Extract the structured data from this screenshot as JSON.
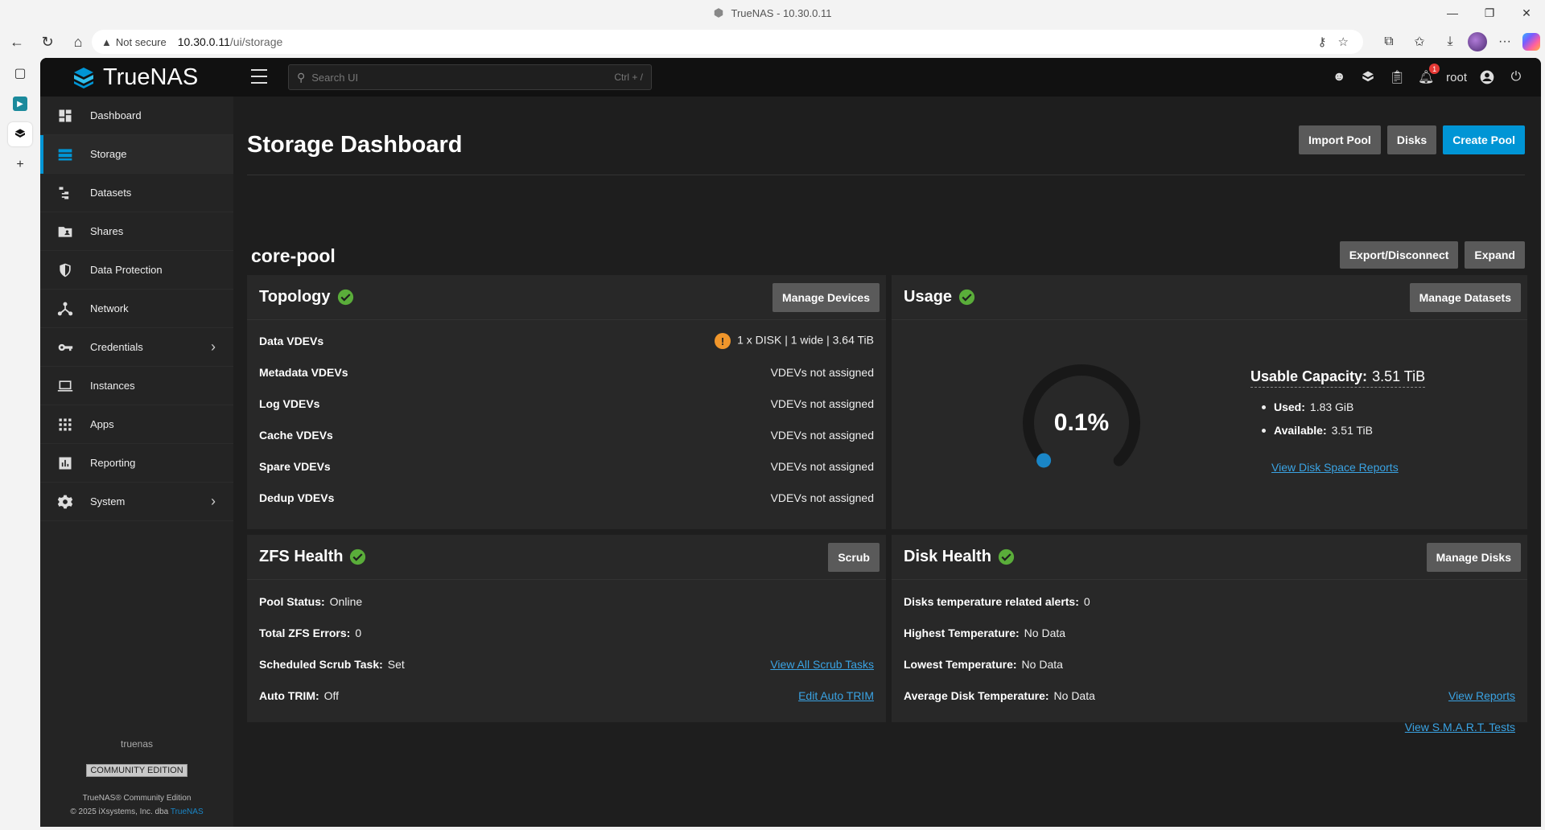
{
  "browser": {
    "window_title": "TrueNAS - 10.30.0.11",
    "not_secure": "Not secure",
    "url_host": "10.30.0.11",
    "url_path": "/ui/storage"
  },
  "app": {
    "logo_text": "TrueNAS",
    "search_placeholder": "Search UI",
    "search_shortcut": "Ctrl + /",
    "notification_count": "1",
    "username": "root"
  },
  "sidebar": {
    "items": [
      {
        "label": "Dashboard"
      },
      {
        "label": "Storage"
      },
      {
        "label": "Datasets"
      },
      {
        "label": "Shares"
      },
      {
        "label": "Data Protection"
      },
      {
        "label": "Network"
      },
      {
        "label": "Credentials"
      },
      {
        "label": "Instances"
      },
      {
        "label": "Apps"
      },
      {
        "label": "Reporting"
      },
      {
        "label": "System"
      }
    ],
    "hostname": "truenas",
    "edition_badge": "COMMUNITY EDITION",
    "copyright_line1": "TrueNAS® Community Edition",
    "copyright_line2": "© 2025 iXsystems, Inc. dba",
    "copyright_link": "TrueNAS"
  },
  "page": {
    "title": "Storage Dashboard",
    "import_pool": "Import Pool",
    "disks": "Disks",
    "create_pool": "Create Pool"
  },
  "pool": {
    "name": "core-pool",
    "export_disconnect": "Export/Disconnect",
    "expand": "Expand"
  },
  "topology": {
    "title": "Topology",
    "manage_devices": "Manage Devices",
    "rows": [
      {
        "label": "Data VDEVs",
        "value": "1 x DISK | 1 wide | 3.64 TiB"
      },
      {
        "label": "Metadata VDEVs",
        "value": "VDEVs not assigned"
      },
      {
        "label": "Log VDEVs",
        "value": "VDEVs not assigned"
      },
      {
        "label": "Cache VDEVs",
        "value": "VDEVs not assigned"
      },
      {
        "label": "Spare VDEVs",
        "value": "VDEVs not assigned"
      },
      {
        "label": "Dedup VDEVs",
        "value": "VDEVs not assigned"
      }
    ],
    "data_vdev_warning": "!"
  },
  "usage": {
    "title": "Usage",
    "manage_datasets": "Manage Datasets",
    "percent_label": "0.1%",
    "percent_value": 0.1,
    "usable_capacity_label": "Usable Capacity:",
    "usable_capacity_value": "3.51 TiB",
    "used_label": "Used:",
    "used_value": "1.83 GiB",
    "available_label": "Available:",
    "available_value": "3.51 TiB",
    "report_link": "View Disk Space Reports"
  },
  "zfs_health": {
    "title": "ZFS Health",
    "scrub": "Scrub",
    "pool_status_label": "Pool Status:",
    "pool_status_value": "Online",
    "errors_label": "Total ZFS Errors:",
    "errors_value": "0",
    "scrub_task_label": "Scheduled Scrub Task:",
    "scrub_task_value": "Set",
    "scrub_link": "View All Scrub Tasks",
    "trim_label": "Auto TRIM:",
    "trim_value": "Off",
    "trim_link": "Edit Auto TRIM"
  },
  "disk_health": {
    "title": "Disk Health",
    "manage_disks": "Manage Disks",
    "temp_alerts_label": "Disks temperature related alerts:",
    "temp_alerts_value": "0",
    "highest_label": "Highest Temperature:",
    "highest_value": "No Data",
    "lowest_label": "Lowest Temperature:",
    "lowest_value": "No Data",
    "avg_label": "Average Disk Temperature:",
    "avg_value": "No Data",
    "reports_link": "View Reports",
    "smart_link": "View S.M.A.R.T. Tests"
  },
  "colors": {
    "accent": "#0095d5",
    "ok": "#5aad3a",
    "warning": "#f0962b"
  }
}
